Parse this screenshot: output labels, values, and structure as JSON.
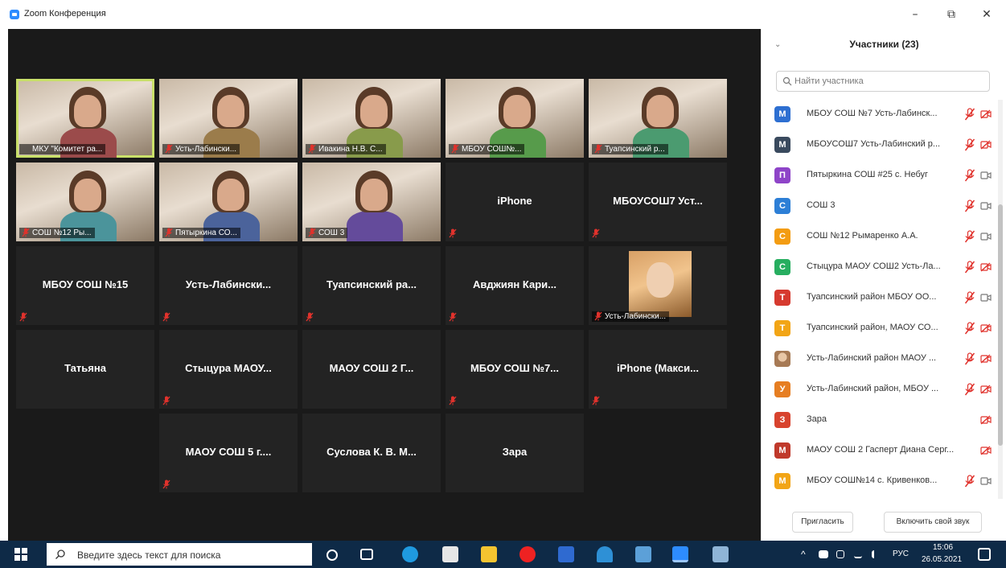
{
  "window": {
    "title": "Zoom Конференция",
    "minimize": "–",
    "restore": "⧉",
    "close": "✕"
  },
  "tiles": [
    {
      "label": "МКУ \"Комитет ра...",
      "type": "video",
      "active": true,
      "muted": false
    },
    {
      "label": "Усть-Лабински...",
      "type": "video",
      "muted": true
    },
    {
      "label": "Ивакина Н.В. С...",
      "type": "video",
      "muted": true
    },
    {
      "label": "МБОУ СОШ№...",
      "type": "video",
      "muted": true
    },
    {
      "label": "Туапсинский р...",
      "type": "video",
      "muted": true
    },
    {
      "label": "СОШ №12 Ры...",
      "type": "video",
      "muted": true
    },
    {
      "label": "Пятыркина СО...",
      "type": "video",
      "muted": true
    },
    {
      "label": "СОШ 3",
      "type": "video",
      "muted": true
    },
    {
      "name": "iPhone",
      "type": "name",
      "muted": true
    },
    {
      "name": "МБОУСОШ7 Уст...",
      "type": "name",
      "muted": true
    },
    {
      "name": "МБОУ СОШ №15",
      "type": "name",
      "muted": true
    },
    {
      "name": "Усть-Лабински...",
      "type": "name",
      "muted": true
    },
    {
      "name": "Туапсинский ра...",
      "type": "name",
      "muted": true
    },
    {
      "name": "Авджиян Кари...",
      "type": "name",
      "muted": true
    },
    {
      "label": "Усть-Лабински...",
      "type": "photo",
      "muted": true
    },
    {
      "name": "Татьяна",
      "type": "name",
      "muted": false
    },
    {
      "name": "Стыцура МАОУ...",
      "type": "name",
      "muted": true
    },
    {
      "name": "МАОУ СОШ 2 Г...",
      "type": "name",
      "muted": false
    },
    {
      "name": "МБОУ СОШ №7...",
      "type": "name",
      "muted": true
    },
    {
      "name": "iPhone (Макси...",
      "type": "name",
      "muted": true
    },
    {
      "name": "МАОУ СОШ 5 г....",
      "type": "name",
      "muted": true
    },
    {
      "name": "Суслова К. В. М...",
      "type": "name",
      "muted": false
    },
    {
      "name": "Зара",
      "type": "name",
      "muted": false
    }
  ],
  "panel": {
    "title": "Участники (23)",
    "collapse": "⌄",
    "search_placeholder": "Найти участника",
    "invite_label": "Пригласить",
    "unmute_label": "Включить свой звук",
    "participants": [
      {
        "initial": "М",
        "color": "#2d6fd1",
        "name": "МБОУ СОШ №7 Усть-Лабинск...",
        "mic": "muted",
        "cam": "off"
      },
      {
        "initial": "М",
        "color": "#3a4a5e",
        "name": "МБОУСОШ7 Усть-Лабинский р...",
        "mic": "muted",
        "cam": "off"
      },
      {
        "initial": "П",
        "color": "#8e44c8",
        "name": "Пятыркина СОШ #25 с. Небуг",
        "mic": "muted",
        "cam": "on"
      },
      {
        "initial": "С",
        "color": "#2d7fd6",
        "name": "СОШ 3",
        "mic": "muted",
        "cam": "on"
      },
      {
        "initial": "С",
        "color": "#f39c12",
        "name": "СОШ №12 Рымаренко А.А.",
        "mic": "muted",
        "cam": "on"
      },
      {
        "initial": "С",
        "color": "#27ae60",
        "name": "Стыцура МАОУ СОШ2 Усть-Ла...",
        "mic": "muted",
        "cam": "off"
      },
      {
        "initial": "Т",
        "color": "#d63a2f",
        "name": "Туапсинский район МБОУ ОО...",
        "mic": "muted",
        "cam": "on"
      },
      {
        "initial": "Т",
        "color": "#f2a516",
        "name": "Туапсинский район, МАОУ СО...",
        "mic": "muted",
        "cam": "off"
      },
      {
        "initial": "",
        "color": "photo",
        "name": "Усть-Лабинский район МАОУ ...",
        "mic": "muted",
        "cam": "off"
      },
      {
        "initial": "У",
        "color": "#e67e22",
        "name": "Усть-Лабинский район, МБОУ ...",
        "mic": "muted",
        "cam": "off"
      },
      {
        "initial": "З",
        "color": "#d8432e",
        "name": "Зара",
        "mic": "none",
        "cam": "off"
      },
      {
        "initial": "М",
        "color": "#c0392b",
        "name": "МАОУ СОШ 2 Гасперт Диана Серг...",
        "mic": "none",
        "cam": "off"
      },
      {
        "initial": "М",
        "color": "#f2a516",
        "name": "МБОУ СОШ№14 с. Кривенков...",
        "mic": "muted",
        "cam": "on"
      }
    ]
  },
  "taskbar": {
    "search_placeholder": "Введите здесь текст для поиска",
    "language": "РУС",
    "time": "15:06",
    "date": "26.05.2021",
    "tray_chevron": "^"
  },
  "colors": {
    "active_speaker_border": "#c9e06a",
    "mute_red": "#e0322c",
    "video_bg": "#1a1a1a",
    "tile_bg": "#232323",
    "taskbar": "#0e2a47"
  }
}
